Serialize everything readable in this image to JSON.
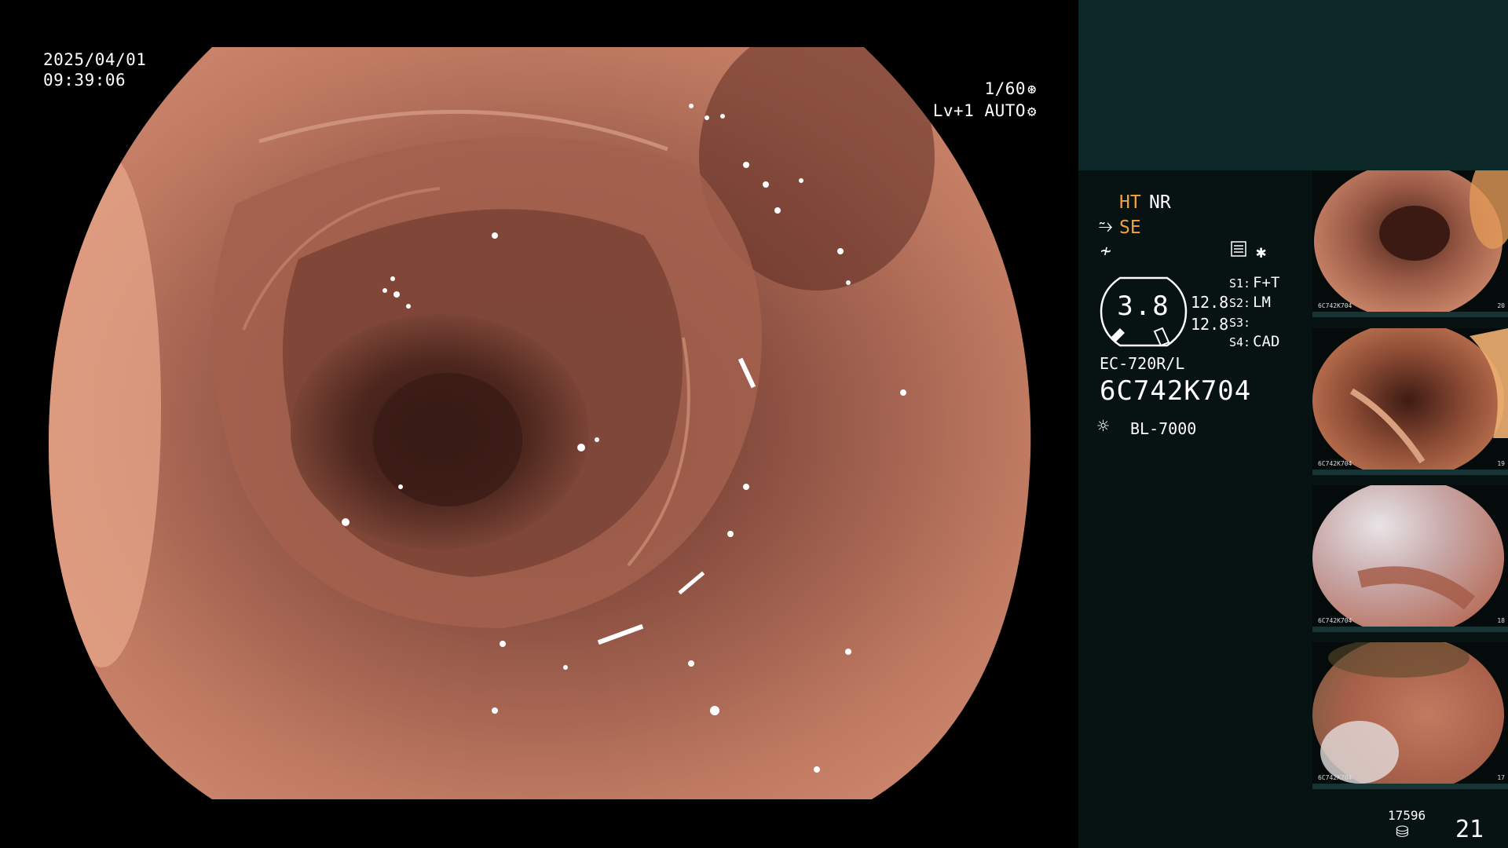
{
  "view": {
    "date": "2025/04/01",
    "time": "09:39:06",
    "shutter": "1/60",
    "level": "Lv+1 AUTO"
  },
  "modes": {
    "ht": "HT",
    "nr": "NR",
    "se": "SE"
  },
  "zoom": {
    "value": "3.8",
    "line1": "12.8",
    "line2": "12.8"
  },
  "switches": [
    {
      "key": "S1:",
      "value": "F+T"
    },
    {
      "key": "S2:",
      "value": "LM"
    },
    {
      "key": "S3:",
      "value": ""
    },
    {
      "key": "S4:",
      "value": "CAD"
    }
  ],
  "scope": {
    "model": "EC-720R/L",
    "serial": "6C742K704"
  },
  "light_source": "BL-7000",
  "storage": {
    "remaining": "17596",
    "image_count": "21"
  },
  "thumbnails": [
    {
      "caption": "6C742K704",
      "index": "20"
    },
    {
      "caption": "6C742K704",
      "index": "19"
    },
    {
      "caption": "6C742K704",
      "index": "18"
    },
    {
      "caption": "6C742K704",
      "index": "17"
    }
  ],
  "icons": {
    "shutter": "aperture-icon",
    "auto": "gear-icon",
    "se": "structure-enhance-icon",
    "f": "freeze-icon",
    "config": "settings-list-icon",
    "star": "asterisk-icon",
    "light": "light-bulb-icon",
    "storage": "disk-stack-icon"
  },
  "colors": {
    "panel_bg": "#071212",
    "panel_top": "#0c2727",
    "accent": "#f2a33c",
    "tissue": "#b9735f"
  }
}
